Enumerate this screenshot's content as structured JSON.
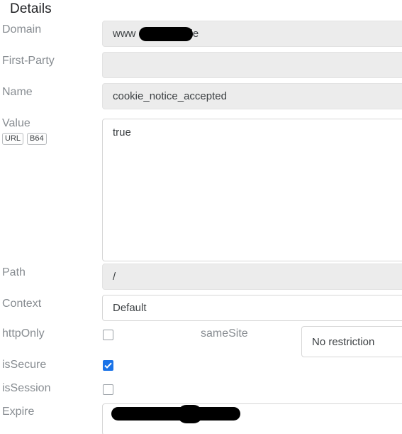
{
  "panel": {
    "title": "Details"
  },
  "rows": {
    "domain": {
      "label": "Domain",
      "value_prefix": "www",
      "value_suffix": "de",
      "redacted": true
    },
    "first_party": {
      "label": "First-Party",
      "value": ""
    },
    "name": {
      "label": "Name",
      "value": "cookie_notice_accepted"
    },
    "value": {
      "label": "Value",
      "value": "true",
      "encoders": [
        {
          "label": "URL",
          "name": "url-encode-button"
        },
        {
          "label": "B64",
          "name": "base64-encode-button"
        }
      ]
    },
    "path": {
      "label": "Path",
      "value": "/"
    },
    "context": {
      "label": "Context",
      "value": "Default"
    },
    "http_only": {
      "label": "httpOnly",
      "checked": false
    },
    "same_site": {
      "label": "sameSite",
      "value": "No restriction"
    },
    "is_secure": {
      "label": "isSecure",
      "checked": true
    },
    "is_session": {
      "label": "isSession",
      "checked": false
    },
    "expire": {
      "label": "Expire",
      "value": "",
      "redacted": true
    }
  },
  "colors": {
    "accent": "#1a73e8",
    "label_text": "#878c91",
    "value_text": "#3c4043",
    "disabled_field_bg": "#ececec",
    "field_border": "#d6d6d6",
    "title_text": "#202124"
  }
}
